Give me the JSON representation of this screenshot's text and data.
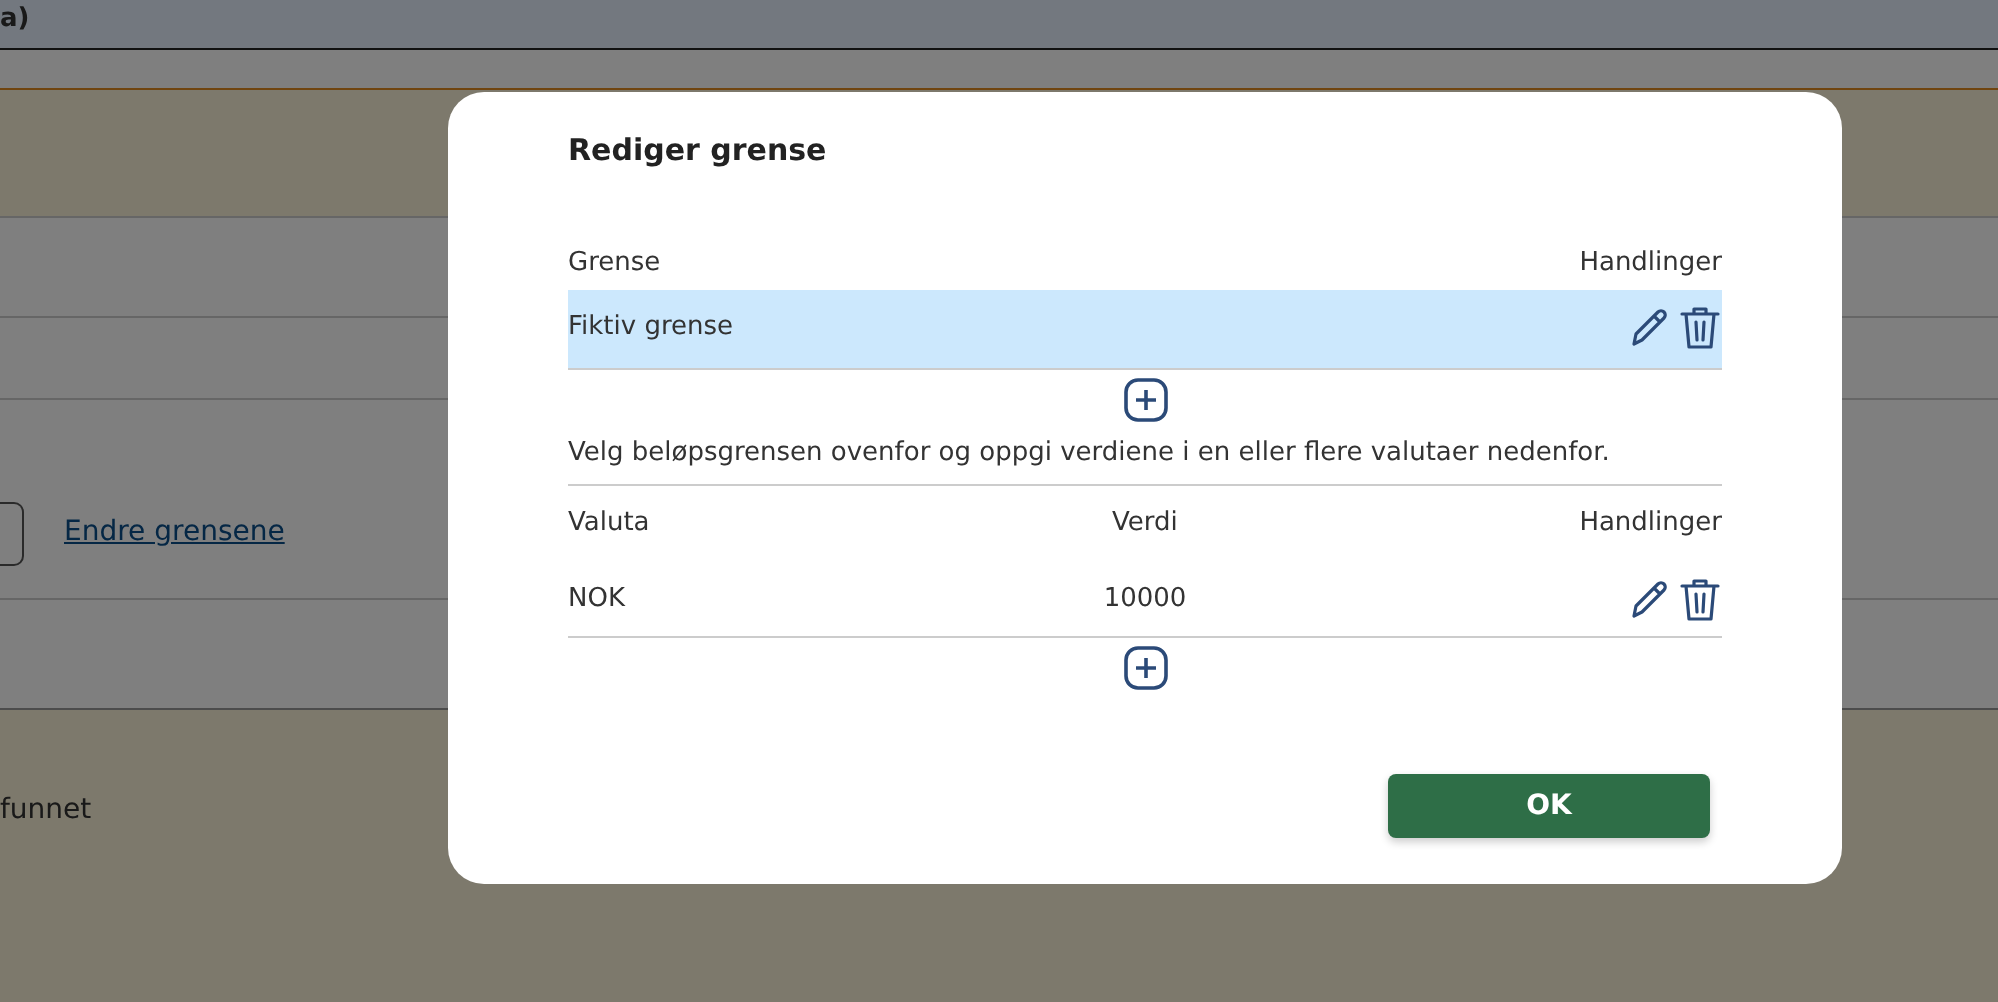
{
  "page": {
    "header_text": "a)",
    "link": "Endre grensene",
    "status_text": "funnet"
  },
  "dialog": {
    "title": "Rediger grense",
    "limits": {
      "columns": [
        "Grense",
        "Handlinger"
      ],
      "rows": [
        {
          "name": "Fiktiv grense",
          "selected": true
        }
      ]
    },
    "instruction": "Velg beløpsgrensen ovenfor og oppgi verdiene i en eller flere valutaer nedenfor.",
    "currencies": {
      "columns": [
        "Valuta",
        "Verdi",
        "Handlinger"
      ],
      "rows": [
        {
          "currency": "NOK",
          "value": "10000",
          "selected": false
        }
      ]
    },
    "ok_button": "OK"
  }
}
